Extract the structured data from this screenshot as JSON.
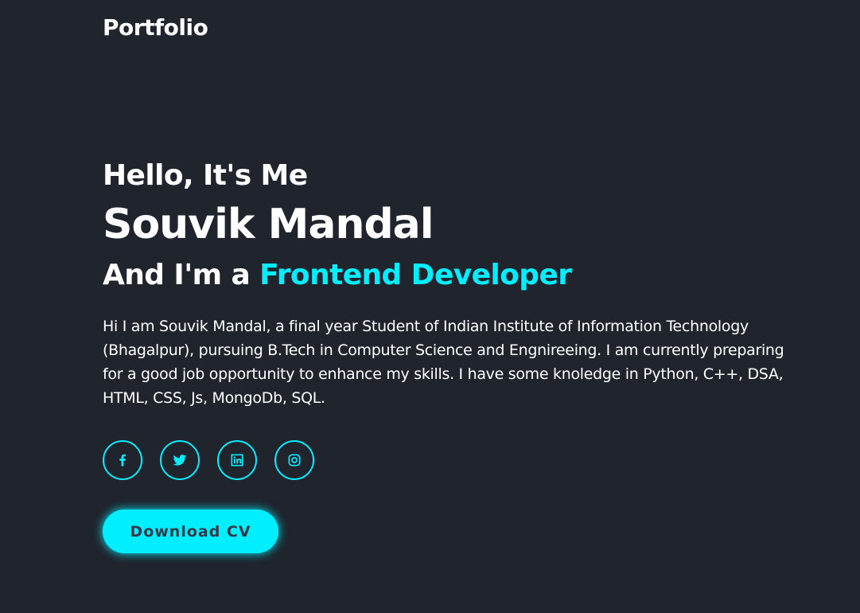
{
  "header": {
    "logo": "Portfolio"
  },
  "home": {
    "greeting": "Hello, It's Me",
    "name": "Souvik Mandal",
    "role_prefix": "And I'm a ",
    "role": "Frontend Developer",
    "bio": "Hi I am Souvik Mandal, a final year Student of Indian Institute of Information Technology (Bhagalpur), pursuing B.Tech in Computer Science and Engnireeing. I am currently preparing for a good job opportunity to enhance my skills. I have some knoledge in Python, C++, DSA, HTML, CSS, Js, MongoDb, SQL.",
    "cta_label": "Download CV"
  },
  "socials": [
    {
      "icon": "facebook-icon"
    },
    {
      "icon": "twitter-icon"
    },
    {
      "icon": "linkedin-icon"
    },
    {
      "icon": "instagram-icon"
    }
  ],
  "colors": {
    "background": "#1f242d",
    "accent": "#00eeff",
    "text": "#ffffff",
    "button_text": "#323946"
  }
}
